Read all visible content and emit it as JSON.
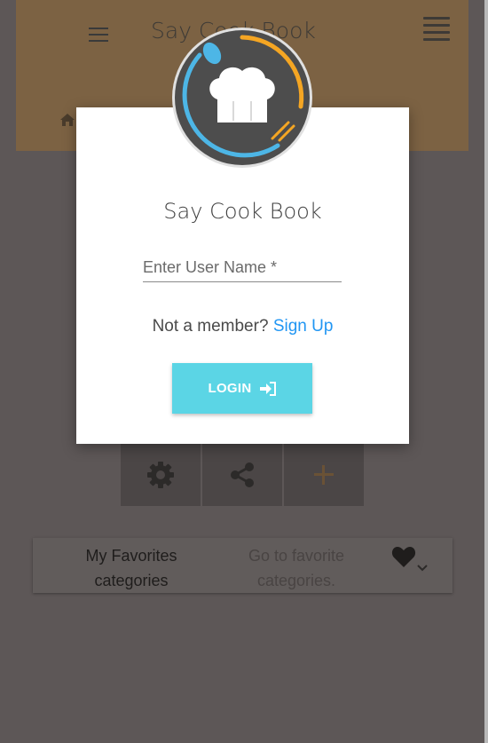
{
  "header": {
    "title": "Say Cook Book",
    "menu_icon": "hamburger-menu-icon",
    "stack_icon": "layers-icon",
    "home_icon": "home-icon",
    "background": "#7c6243"
  },
  "tiles": [
    {
      "icon": "gear-icon"
    },
    {
      "icon": "share-icon"
    },
    {
      "icon": "plus-icon"
    }
  ],
  "favorites": {
    "title": "My Favorites categories",
    "subtitle": "Go to favorite categories.",
    "icons": [
      "heart-icon",
      "chevron-down-icon"
    ]
  },
  "login_modal": {
    "title": "Say Cook Book",
    "username_placeholder": "Enter User Name *",
    "username_value": "",
    "member_text": "Not a member?",
    "signup_link": "Sign Up",
    "login_button": "LOGIN",
    "login_icon": "sign-in-icon",
    "accent_color": "#5bd5e5",
    "link_color": "#2196f3"
  },
  "logo": {
    "icon": "chef-hat-icon",
    "ring_colors": [
      "#f5a623",
      "#4db6e6"
    ]
  }
}
